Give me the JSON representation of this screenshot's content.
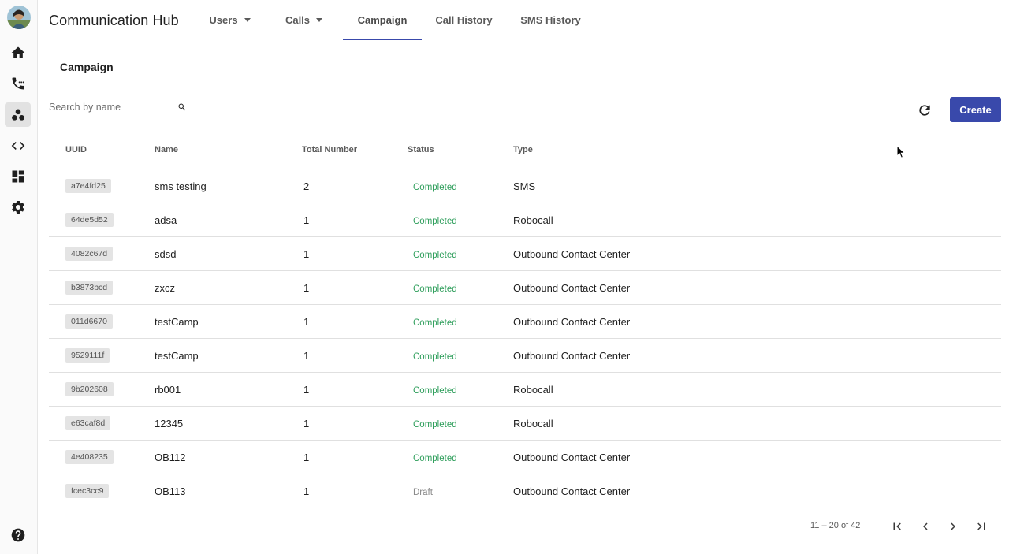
{
  "app": {
    "title": "Communication Hub"
  },
  "sidebar": {
    "items": [
      {
        "name": "home",
        "icon": "home-icon"
      },
      {
        "name": "calls",
        "icon": "phone-dialpad-icon"
      },
      {
        "name": "campaign",
        "icon": "groups-icon",
        "active": true
      },
      {
        "name": "developer",
        "icon": "code-icon"
      },
      {
        "name": "dashboard",
        "icon": "dashboard-icon"
      },
      {
        "name": "settings",
        "icon": "gear-icon"
      }
    ],
    "help_icon": "help-icon"
  },
  "tabs": [
    {
      "label": "Users",
      "dropdown": true
    },
    {
      "label": "Calls",
      "dropdown": true
    },
    {
      "label": "Campaign",
      "active": true
    },
    {
      "label": "Call History"
    },
    {
      "label": "SMS History"
    }
  ],
  "page": {
    "title": "Campaign"
  },
  "search": {
    "placeholder": "Search by name",
    "value": ""
  },
  "toolbar": {
    "create_label": "Create"
  },
  "table": {
    "headers": {
      "uuid": "UUID",
      "name": "Name",
      "total": "Total Number",
      "status": "Status",
      "type": "Type"
    },
    "rows": [
      {
        "uuid": "a7e4fd25",
        "name": "sms testing",
        "total": "2",
        "status": "Completed",
        "type": "SMS"
      },
      {
        "uuid": "64de5d52",
        "name": "adsa",
        "total": "1",
        "status": "Completed",
        "type": "Robocall"
      },
      {
        "uuid": "4082c67d",
        "name": "sdsd",
        "total": "1",
        "status": "Completed",
        "type": "Outbound Contact Center"
      },
      {
        "uuid": "b3873bcd",
        "name": "zxcz",
        "total": "1",
        "status": "Completed",
        "type": "Outbound Contact Center"
      },
      {
        "uuid": "011d6670",
        "name": "testCamp",
        "total": "1",
        "status": "Completed",
        "type": "Outbound Contact Center"
      },
      {
        "uuid": "9529111f",
        "name": "testCamp",
        "total": "1",
        "status": "Completed",
        "type": "Outbound Contact Center"
      },
      {
        "uuid": "9b202608",
        "name": "rb001",
        "total": "1",
        "status": "Completed",
        "type": "Robocall"
      },
      {
        "uuid": "e63caf8d",
        "name": "12345",
        "total": "1",
        "status": "Completed",
        "type": "Robocall"
      },
      {
        "uuid": "4e408235",
        "name": "OB112",
        "total": "1",
        "status": "Completed",
        "type": "Outbound Contact Center"
      },
      {
        "uuid": "fcec3cc9",
        "name": "OB113",
        "total": "1",
        "status": "Draft",
        "type": "Outbound Contact Center"
      }
    ]
  },
  "pagination": {
    "range_label": "11 – 20 of 42"
  },
  "colors": {
    "accent": "#3949ab",
    "completed": "#2e9e5b",
    "draft": "#8a8a8a"
  }
}
